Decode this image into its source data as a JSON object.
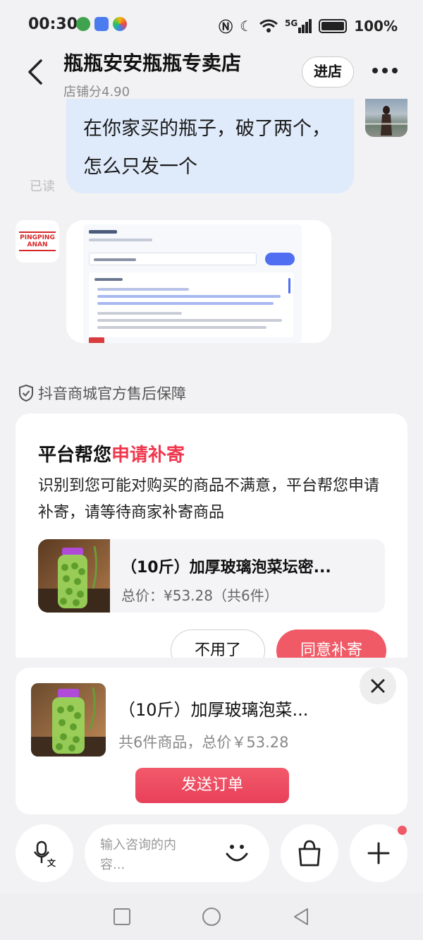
{
  "status_bar": {
    "time": "00:30",
    "network": "5G",
    "battery": "100%"
  },
  "header": {
    "title": "瓶瓶安安瓶瓶专卖店",
    "score": "店铺分4.90",
    "enter_label": "进店"
  },
  "chat": {
    "my_message": "在你家买的瓶子，破了两个，怎么只发一个",
    "read_status": "已读",
    "shop_logo_text": "PINGPING ANAN"
  },
  "guarantee": {
    "label": "抖音商城官方售后保障"
  },
  "aftersale_card": {
    "title_prefix": "平台帮您",
    "title_highlight": "申请补寄",
    "description": "识别到您可能对购买的商品不满意，平台帮您申请补寄，请等待商家补寄商品",
    "product_name": "（10斤）加厚玻璃泡菜坛密...",
    "product_total": "总价：¥53.28（共6件）",
    "decline_label": "不用了",
    "accept_label": "同意补寄"
  },
  "order_card": {
    "product_name": "（10斤）加厚玻璃泡菜...",
    "summary": "共6件商品，总价￥53.28",
    "send_label": "发送订单"
  },
  "input_bar": {
    "placeholder": "输入咨询的内容..."
  },
  "colors": {
    "accent": "#f0384f",
    "bubble": "#dfeafb"
  }
}
